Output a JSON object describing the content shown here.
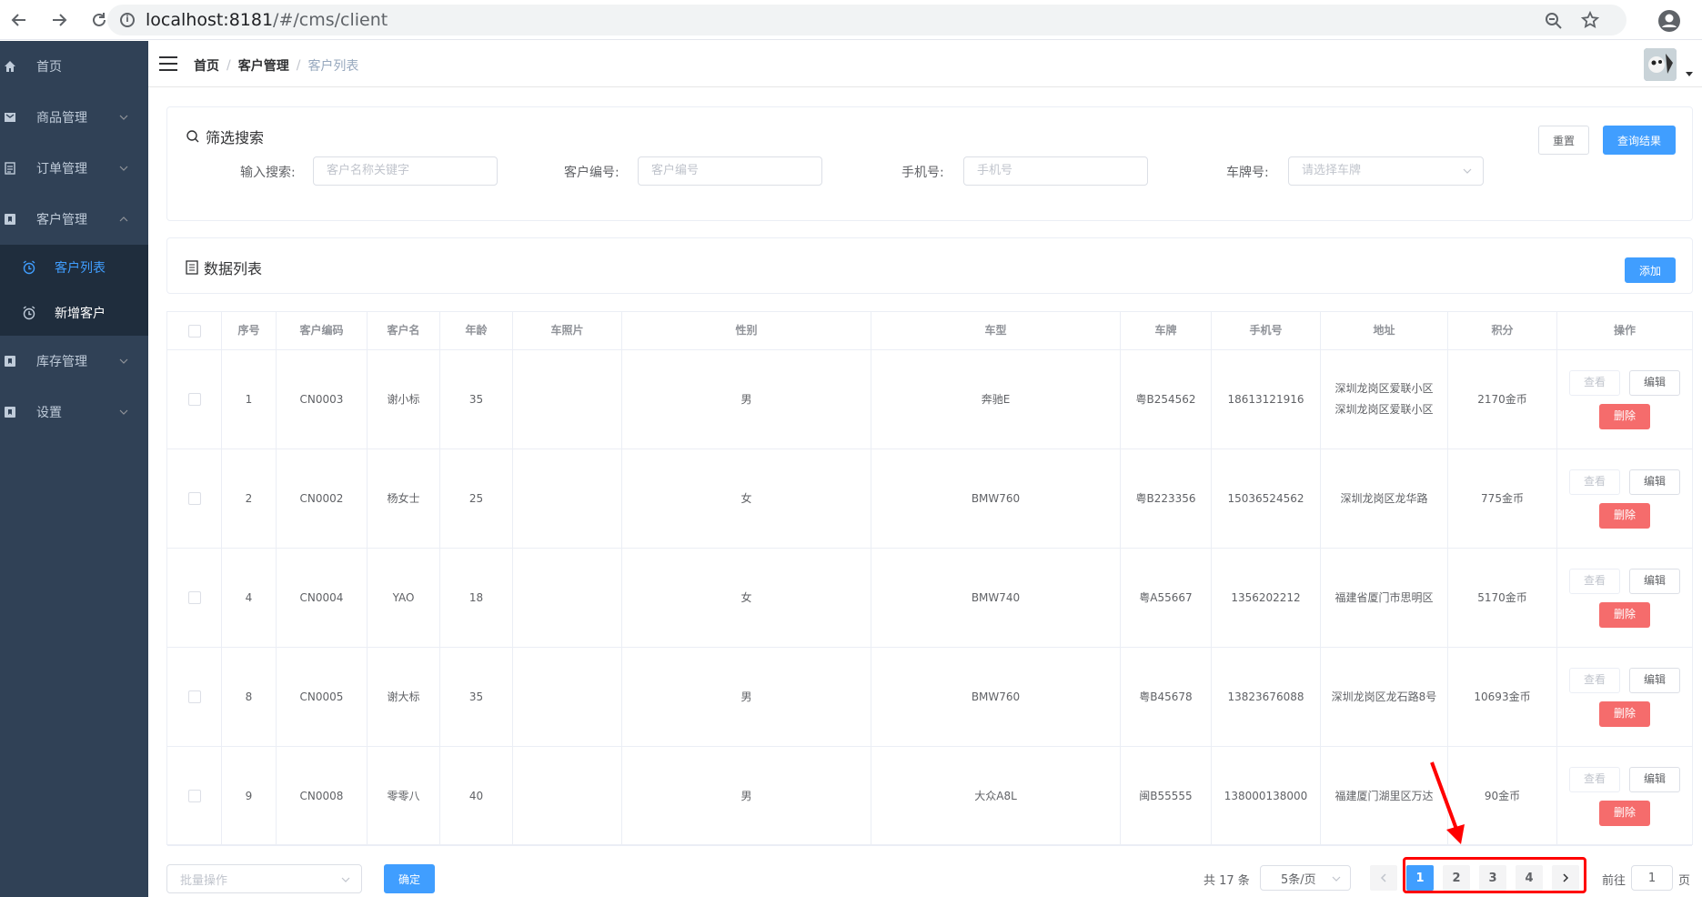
{
  "browser": {
    "url_host": "localhost:8181",
    "url_path": "/#/cms/client"
  },
  "sidebar": {
    "items": [
      {
        "label": "首页",
        "icon": "home-icon"
      },
      {
        "label": "商品管理",
        "icon": "goods-icon"
      },
      {
        "label": "订单管理",
        "icon": "order-icon"
      },
      {
        "label": "客户管理",
        "icon": "customer-icon"
      },
      {
        "label": "库存管理",
        "icon": "stock-icon"
      },
      {
        "label": "设置",
        "icon": "settings-icon"
      }
    ],
    "submenu": [
      {
        "label": "客户列表",
        "icon": "alarm-clock-icon",
        "active": true
      },
      {
        "label": "新增客户",
        "icon": "alarm-clock-icon",
        "active": false
      }
    ]
  },
  "breadcrumb": [
    "首页",
    "客户管理",
    "客户列表"
  ],
  "filter": {
    "title": "筛选搜索",
    "search_label": "输入搜索:",
    "search_placeholder": "客户名称关键字",
    "code_label": "客户编号:",
    "code_placeholder": "客户编号",
    "phone_label": "手机号:",
    "phone_placeholder": "手机号",
    "plate_label": "车牌号:",
    "plate_placeholder": "请选择车牌",
    "reset_label": "重置",
    "query_label": "查询结果"
  },
  "list": {
    "title": "数据列表",
    "add_label": "添加"
  },
  "table": {
    "headers": [
      "序号",
      "客户编码",
      "客户名",
      "年龄",
      "车照片",
      "性别",
      "车型",
      "车牌",
      "手机号",
      "地址",
      "积分",
      "操作"
    ],
    "rows": [
      {
        "no": "1",
        "code": "CN0003",
        "name": "谢小标",
        "age": "35",
        "photo": "",
        "gender": "男",
        "model": "奔驰E",
        "plate": "粤B254562",
        "phone": "18613121916",
        "address": "深圳龙岗区爱联小区 深圳龙岗区爱联小区",
        "points": "2170金币"
      },
      {
        "no": "2",
        "code": "CN0002",
        "name": "杨女士",
        "age": "25",
        "photo": "",
        "gender": "女",
        "model": "BMW760",
        "plate": "粤B223356",
        "phone": "15036524562",
        "address": "深圳龙岗区龙华路",
        "points": "775金币"
      },
      {
        "no": "4",
        "code": "CN0004",
        "name": "YAO",
        "age": "18",
        "photo": "",
        "gender": "女",
        "model": "BMW740",
        "plate": "粤A55667",
        "phone": "1356202212",
        "address": "福建省厦门市思明区",
        "points": "5170金币"
      },
      {
        "no": "8",
        "code": "CN0005",
        "name": "谢大标",
        "age": "35",
        "photo": "",
        "gender": "男",
        "model": "BMW760",
        "plate": "粤B45678",
        "phone": "13823676088",
        "address": "深圳龙岗区龙石路8号",
        "points": "10693金币"
      },
      {
        "no": "9",
        "code": "CN0008",
        "name": "零零八",
        "age": "40",
        "photo": "",
        "gender": "男",
        "model": "大众A8L",
        "plate": "闽B55555",
        "phone": "138000138000",
        "address": "福建厦门湖里区万达",
        "points": "90金币"
      }
    ],
    "op_view": "查看",
    "op_edit": "编辑",
    "op_delete": "删除"
  },
  "footer": {
    "batch_placeholder": "批量操作",
    "confirm_label": "确定",
    "total": "共 17 条",
    "page_size": "5条/页",
    "pages": [
      "1",
      "2",
      "3",
      "4"
    ],
    "current_page": "1",
    "goto_prefix": "前往",
    "goto_value": "1",
    "goto_suffix": "页"
  },
  "colors": {
    "sidebar_bg": "#304156",
    "primary": "#409eff",
    "danger": "#f56c6c",
    "highlight": "#ff0000"
  }
}
